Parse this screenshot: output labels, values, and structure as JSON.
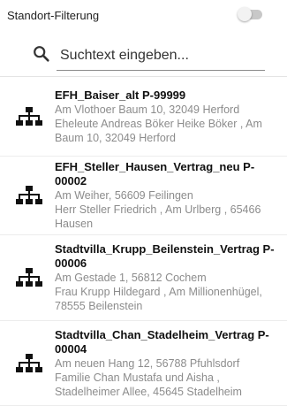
{
  "filter": {
    "label": "Standort-Filterung",
    "enabled": false
  },
  "search": {
    "placeholder": "Suchtext eingeben...",
    "value": ""
  },
  "colors": {
    "icon": "#111111",
    "secondary_text": "#8c8c8c",
    "toggle_off": "#c8c8c8"
  },
  "items": [
    {
      "icon": "hierarchy-icon",
      "title": "EFH_Baiser_alt P-99999",
      "address": "Am Vlothoer Baum 10, 32049 Herford",
      "contact": "Eheleute Andreas Böker Heike Böker , Am Baum 10, 32049 Herford"
    },
    {
      "icon": "hierarchy-icon",
      "title": "EFH_Steller_Hausen_Vertrag_neu P-00002",
      "address": "Am Weiher, 56609 Feilingen",
      "contact": "Herr Steller Friedrich , Am Urlberg , 65466 Hausen"
    },
    {
      "icon": "hierarchy-icon",
      "title": "Stadtvilla_Krupp_Beilenstein_Vertrag P-00006",
      "address": "Am Gestade 1, 56812 Cochem",
      "contact": "Frau Krupp Hildegard , Am Millionenhügel, 78555 Beilenstein"
    },
    {
      "icon": "hierarchy-icon",
      "title": "Stadtvilla_Chan_Stadelheim_Vertrag P-00004",
      "address": "Am neuen Hang 12, 56788 Pfuhlsdorf",
      "contact": "Familie Chan Mustafa und Aisha , Stadelheimer Allee, 45645 Stadelheim"
    }
  ]
}
